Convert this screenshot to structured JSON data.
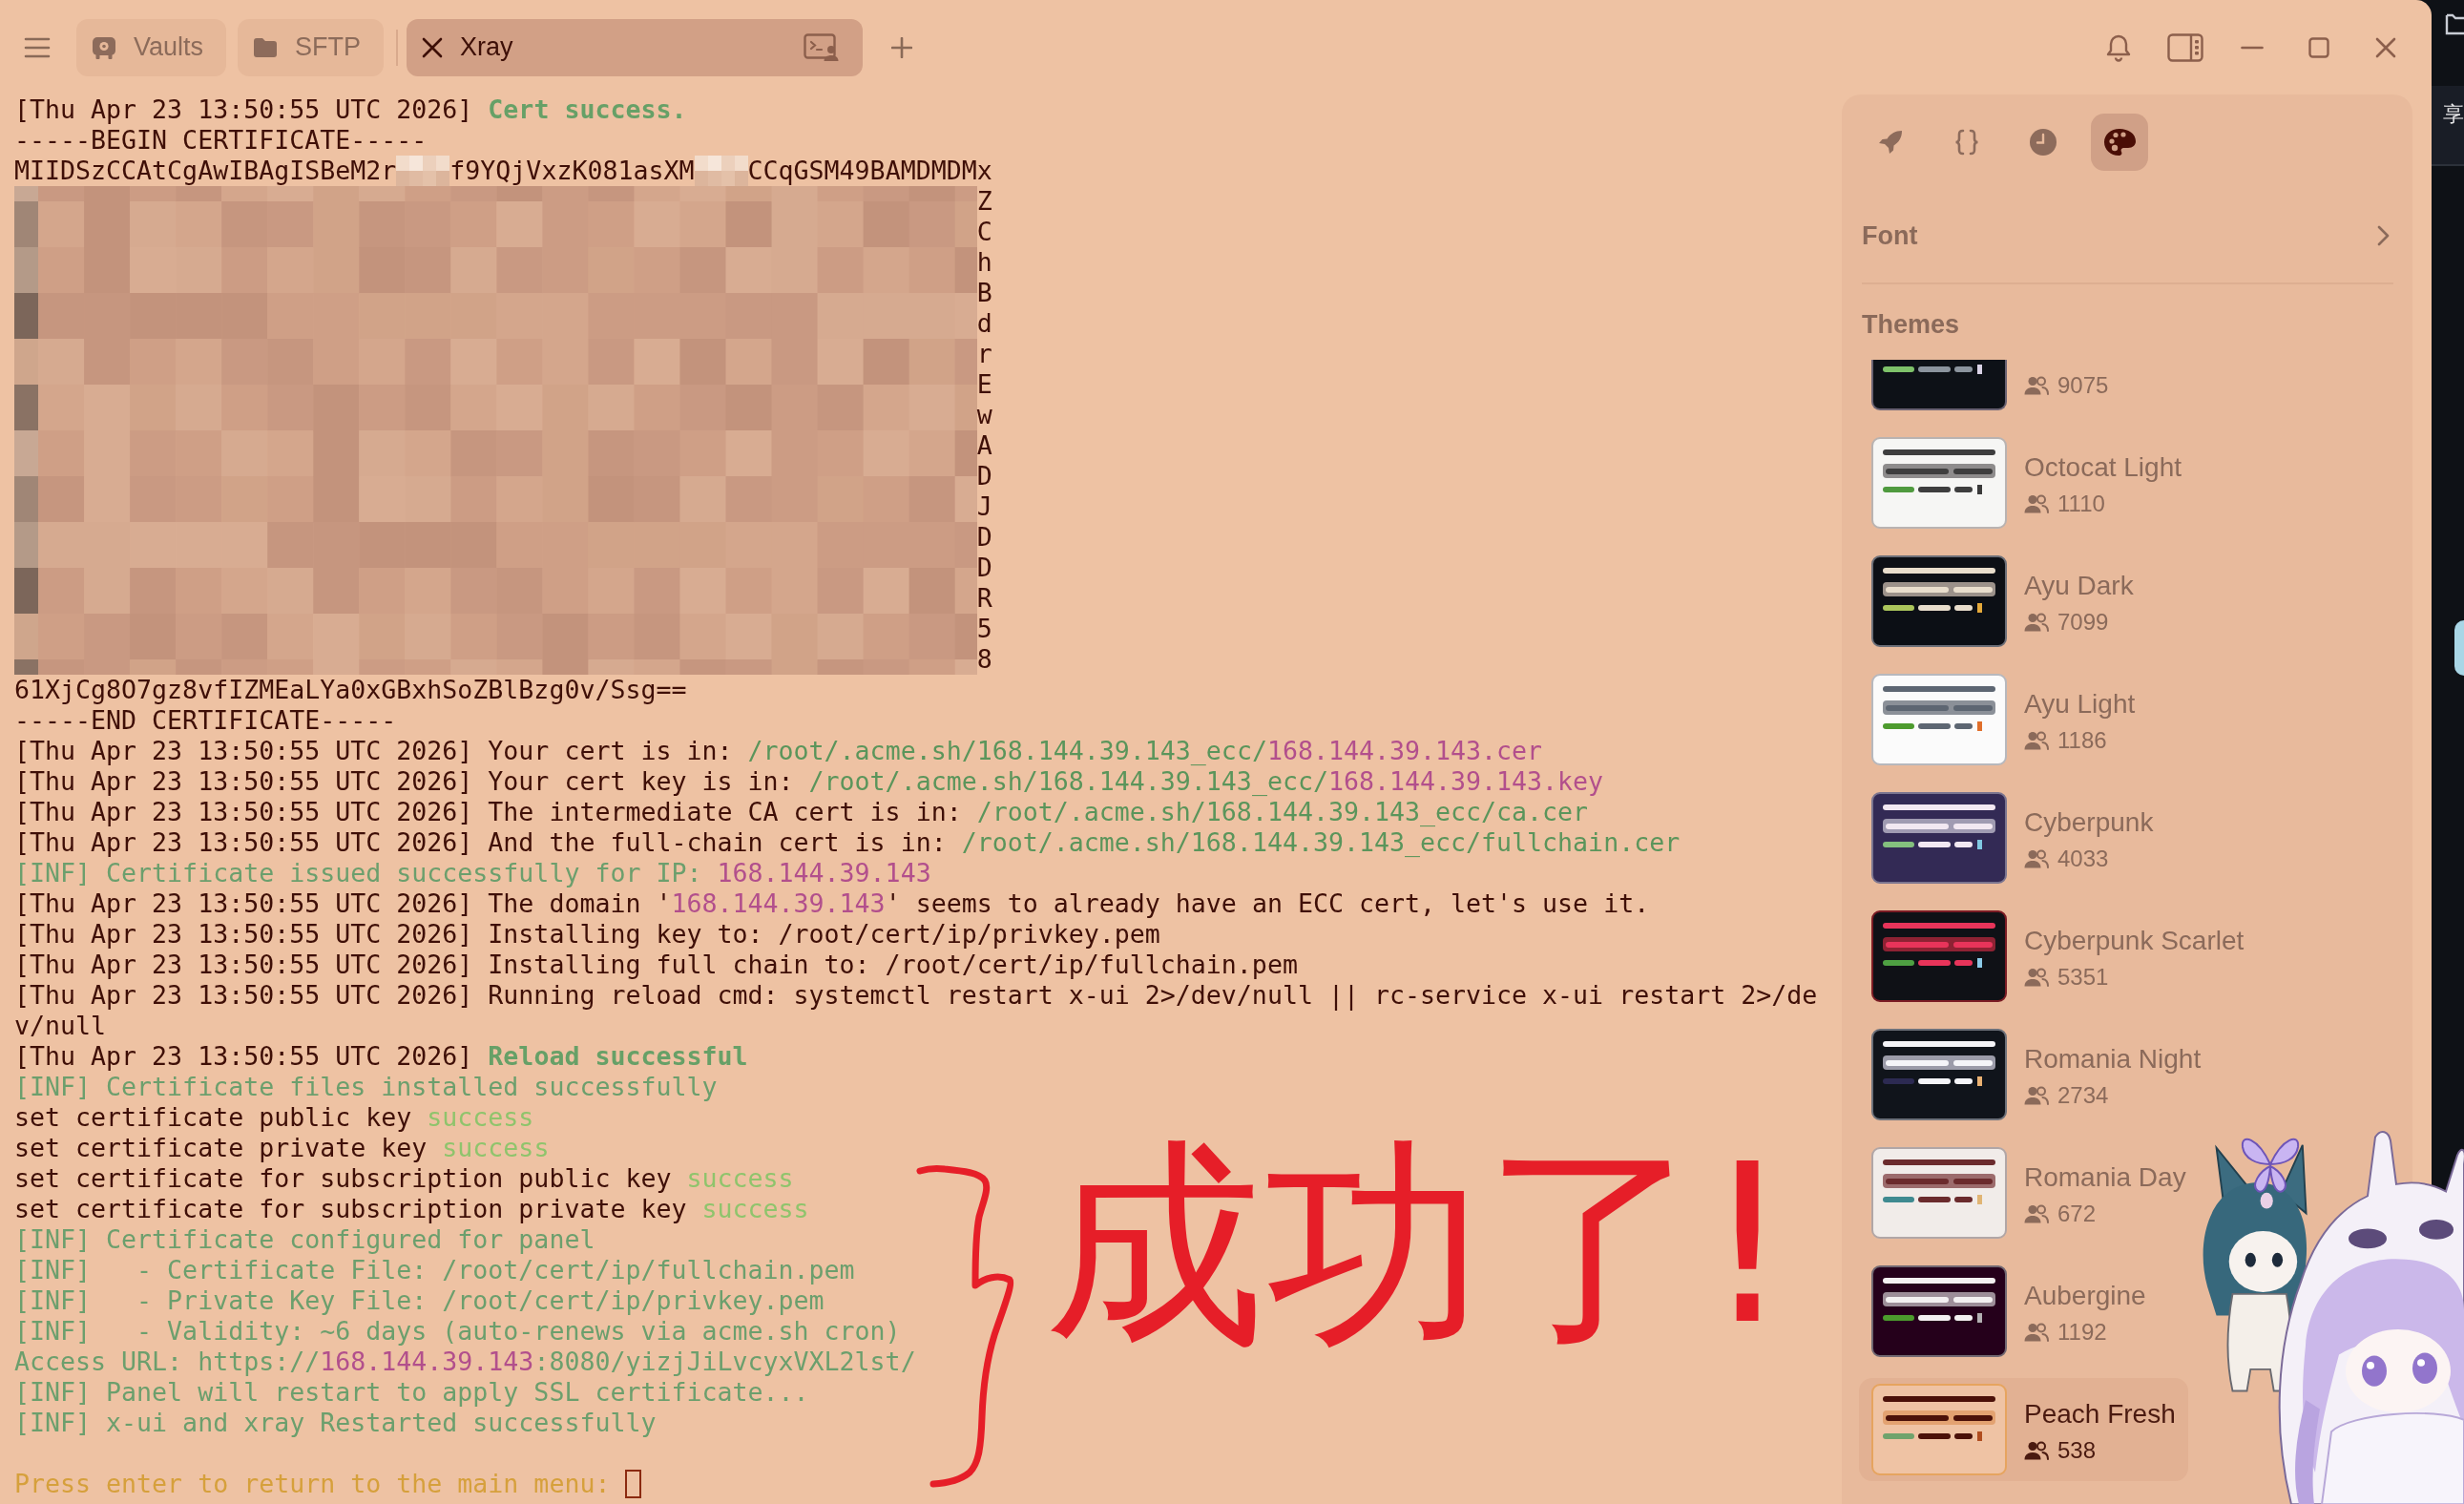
{
  "toolbar": {
    "tabs": [
      {
        "label": "Vaults",
        "kind": "vaults",
        "selected": false
      },
      {
        "label": "SFTP",
        "kind": "sftp",
        "selected": false
      },
      {
        "label": "Xray",
        "kind": "host",
        "selected": true
      }
    ]
  },
  "terminal": {
    "lines": [
      {
        "segments": [
          {
            "kind": "plain",
            "text": "[Thu Apr 23 13:50:55 UTC 2026] "
          },
          {
            "kind": "success",
            "text": "Cert success."
          }
        ]
      },
      {
        "segments": [
          {
            "kind": "plain",
            "text": "-----BEGIN CERTIFICATE-----"
          }
        ]
      },
      {
        "segments": [
          {
            "kind": "plain",
            "text": "MIIDSzCCAtCgAwIBAgISBeM2r"
          },
          {
            "kind": "redacted"
          },
          {
            "kind": "plain",
            "text": "f9YQjVxzK081asXM"
          },
          {
            "kind": "redacted"
          },
          {
            "kind": "plain",
            "text": "CCqGSM49BAMDMDMx"
          }
        ]
      },
      {
        "segments": [
          {
            "kind": "redacted_block"
          },
          {
            "kind": "plain",
            "text": "Z"
          }
        ]
      },
      {
        "segments": [
          {
            "kind": "redacted_block"
          },
          {
            "kind": "plain",
            "text": "C"
          }
        ]
      },
      {
        "segments": [
          {
            "kind": "redacted_block"
          },
          {
            "kind": "plain",
            "text": "h"
          }
        ]
      },
      {
        "segments": [
          {
            "kind": "redacted_block"
          },
          {
            "kind": "plain",
            "text": "B"
          }
        ]
      },
      {
        "segments": [
          {
            "kind": "redacted_block"
          },
          {
            "kind": "plain",
            "text": "d"
          }
        ]
      },
      {
        "segments": [
          {
            "kind": "redacted_block"
          },
          {
            "kind": "plain",
            "text": "r"
          }
        ]
      },
      {
        "segments": [
          {
            "kind": "redacted_block"
          },
          {
            "kind": "plain",
            "text": "E"
          }
        ]
      },
      {
        "segments": [
          {
            "kind": "redacted_block"
          },
          {
            "kind": "plain",
            "text": "w"
          }
        ]
      },
      {
        "segments": [
          {
            "kind": "redacted_block"
          },
          {
            "kind": "plain",
            "text": "A"
          }
        ]
      },
      {
        "segments": [
          {
            "kind": "redacted_block"
          },
          {
            "kind": "plain",
            "text": "D"
          }
        ]
      },
      {
        "segments": [
          {
            "kind": "redacted_block"
          },
          {
            "kind": "plain",
            "text": "J"
          }
        ]
      },
      {
        "segments": [
          {
            "kind": "redacted_block"
          },
          {
            "kind": "plain",
            "text": "D"
          }
        ]
      },
      {
        "segments": [
          {
            "kind": "redacted_block"
          },
          {
            "kind": "plain",
            "text": "D"
          }
        ]
      },
      {
        "segments": [
          {
            "kind": "redacted_block"
          },
          {
            "kind": "plain",
            "text": "R"
          }
        ]
      },
      {
        "segments": [
          {
            "kind": "redacted_block"
          },
          {
            "kind": "plain",
            "text": "5"
          }
        ]
      },
      {
        "segments": [
          {
            "kind": "redacted_block"
          },
          {
            "kind": "plain",
            "text": "8"
          }
        ]
      },
      {
        "segments": [
          {
            "kind": "plain",
            "text": "61XjCg8O7gz8vfIZMEaLYa0xGBxhSoZBlBzg0v/Ssg=="
          }
        ]
      },
      {
        "segments": [
          {
            "kind": "plain",
            "text": "-----END CERTIFICATE-----"
          }
        ]
      },
      {
        "segments": [
          {
            "kind": "plain",
            "text": "[Thu Apr 23 13:50:55 UTC 2026] Your cert is in: "
          },
          {
            "kind": "path",
            "text": "/root/.acme.sh/168.144.39.143_ecc/"
          },
          {
            "kind": "ip",
            "text": "168.144.39.143.cer"
          }
        ]
      },
      {
        "segments": [
          {
            "kind": "plain",
            "text": "[Thu Apr 23 13:50:55 UTC 2026] Your cert key is in: "
          },
          {
            "kind": "path",
            "text": "/root/.acme.sh/168.144.39.143_ecc/"
          },
          {
            "kind": "ip",
            "text": "168.144.39.143.key"
          }
        ]
      },
      {
        "segments": [
          {
            "kind": "plain",
            "text": "[Thu Apr 23 13:50:55 UTC 2026] The intermediate CA cert is in: "
          },
          {
            "kind": "path",
            "text": "/root/.acme.sh/168.144.39.143_ecc/ca.cer"
          }
        ]
      },
      {
        "segments": [
          {
            "kind": "plain",
            "text": "[Thu Apr 23 13:50:55 UTC 2026] And the full-chain cert is in: "
          },
          {
            "kind": "path",
            "text": "/root/.acme.sh/168.144.39.143_ecc/fullchain.cer"
          }
        ]
      },
      {
        "segments": [
          {
            "kind": "info",
            "text": "[INF] Certificate issued successfully for IP: "
          },
          {
            "kind": "ip",
            "text": "168.144.39.143"
          }
        ]
      },
      {
        "segments": [
          {
            "kind": "plain",
            "text": "[Thu Apr 23 13:50:55 UTC 2026] The domain '"
          },
          {
            "kind": "ip",
            "text": "168.144.39.143"
          },
          {
            "kind": "plain",
            "text": "' seems to already have an ECC cert, let's use it."
          }
        ]
      },
      {
        "segments": [
          {
            "kind": "plain",
            "text": "[Thu Apr 23 13:50:55 UTC 2026] Installing key to: /root/cert/ip/privkey.pem"
          }
        ]
      },
      {
        "segments": [
          {
            "kind": "plain",
            "text": "[Thu Apr 23 13:50:55 UTC 2026] Installing full chain to: /root/cert/ip/fullchain.pem"
          }
        ]
      },
      {
        "segments": [
          {
            "kind": "plain",
            "text": "[Thu Apr 23 13:50:55 UTC 2026] Running reload cmd: systemctl restart x-ui 2>/dev/null || rc-service x-ui restart 2>/de"
          }
        ]
      },
      {
        "segments": [
          {
            "kind": "plain",
            "text": "v/null"
          }
        ]
      },
      {
        "segments": [
          {
            "kind": "plain",
            "text": "[Thu Apr 23 13:50:55 UTC 2026] "
          },
          {
            "kind": "success",
            "text": "Reload successful"
          }
        ]
      },
      {
        "segments": [
          {
            "kind": "info",
            "text": "[INF] Certificate files installed successfully"
          }
        ]
      },
      {
        "segments": [
          {
            "kind": "plain",
            "text": "set certificate public key "
          },
          {
            "kind": "ok",
            "text": "success"
          }
        ]
      },
      {
        "segments": [
          {
            "kind": "plain",
            "text": "set certificate private key "
          },
          {
            "kind": "ok",
            "text": "success"
          }
        ]
      },
      {
        "segments": [
          {
            "kind": "plain",
            "text": "set certificate for subscription public key "
          },
          {
            "kind": "ok",
            "text": "success"
          }
        ]
      },
      {
        "segments": [
          {
            "kind": "plain",
            "text": "set certificate for subscription private key "
          },
          {
            "kind": "ok",
            "text": "success"
          }
        ]
      },
      {
        "segments": [
          {
            "kind": "info",
            "text": "[INF] Certificate configured for panel"
          }
        ]
      },
      {
        "segments": [
          {
            "kind": "info",
            "text": "[INF]   - Certificate File: /root/cert/ip/fullchain.pem"
          }
        ]
      },
      {
        "segments": [
          {
            "kind": "info",
            "text": "[INF]   - Private Key File: /root/cert/ip/privkey.pem"
          }
        ]
      },
      {
        "segments": [
          {
            "kind": "info",
            "text": "[INF]   - Validity: ~6 days (auto-renews via acme.sh cron)"
          }
        ]
      },
      {
        "segments": [
          {
            "kind": "info",
            "text": "Access URL: https://"
          },
          {
            "kind": "ip",
            "text": "168.144.39.143"
          },
          {
            "kind": "info",
            "text": ":8080/yizjJiLvcyxVXL2lst/"
          }
        ]
      },
      {
        "segments": [
          {
            "kind": "info",
            "text": "[INF] Panel will restart to apply SSL certificate..."
          }
        ]
      },
      {
        "segments": [
          {
            "kind": "info",
            "text": "[INF] x-ui and xray Restarted successfully"
          }
        ]
      }
    ],
    "prompt": {
      "text": "Press enter to return to the main menu: ",
      "cursor": true
    }
  },
  "annotation": {
    "text": "成功了!"
  },
  "side_panel": {
    "tools": [
      {
        "selected": false
      },
      {
        "selected": false
      },
      {
        "selected": false
      },
      {
        "selected": true
      }
    ],
    "font_row": {
      "label": "Font"
    },
    "themes": {
      "heading": "Themes",
      "items": [
        {
          "users": "9075",
          "selected": false,
          "palette": [
            {
              "color": "#0d1117"
            },
            {
              "color": "#6a6272"
            },
            {
              "color": "#8b949e"
            },
            {
              "color": "#7ec26a"
            },
            {
              "color": "#d9d2e6"
            }
          ]
        },
        {
          "name": "Octocat Light",
          "users": "1110",
          "selected": false,
          "palette": [
            {
              "color": "#f6f6f4"
            },
            {
              "color": "#b9b3b1"
            },
            {
              "color": "#3e3e3e"
            },
            {
              "color": "#4f9a3e"
            },
            {
              "color": "#3a3a3a"
            },
            {
              "color": "#8e8c8c"
            }
          ]
        },
        {
          "name": "Ayu Dark",
          "users": "7099",
          "selected": false,
          "palette": [
            {
              "color": "#0c0f15"
            },
            {
              "color": "#6c6f78"
            },
            {
              "color": "#e8ddcc"
            },
            {
              "color": "#abc55c"
            },
            {
              "color": "#e5a93a"
            },
            {
              "color": "#9b918a"
            }
          ]
        },
        {
          "name": "Ayu Light",
          "users": "1186",
          "selected": false,
          "palette": [
            {
              "color": "#fbfbfb"
            },
            {
              "color": "#b7b8bd"
            },
            {
              "color": "#5d6672"
            },
            {
              "color": "#4d9b2e"
            },
            {
              "color": "#e06f2b"
            },
            {
              "color": "#8b9098"
            }
          ]
        },
        {
          "name": "Cyberpunk",
          "users": "4033",
          "selected": false,
          "palette": [
            {
              "color": "#332a55"
            },
            {
              "color": "#7b7590"
            },
            {
              "color": "#f2e8f2"
            },
            {
              "color": "#84c07e"
            },
            {
              "color": "#80c8e2"
            },
            {
              "color": "#a09bb2"
            }
          ]
        },
        {
          "name": "Cyberpunk Scarlet",
          "users": "5351",
          "selected": false,
          "palette": [
            {
              "color": "#0f1116"
            },
            {
              "color": "#7b1c24"
            },
            {
              "color": "#e8345a"
            },
            {
              "color": "#4ea042"
            },
            {
              "color": "#8ccbe8"
            },
            {
              "color": "#8e2233"
            }
          ]
        },
        {
          "name": "Romania Night",
          "users": "2734",
          "selected": false,
          "palette": [
            {
              "color": "#10141b"
            },
            {
              "color": "#6d717a"
            },
            {
              "color": "#f4f4f8"
            },
            {
              "color": "#2c2a52"
            },
            {
              "color": "#eab172"
            },
            {
              "color": "#9b9ba9"
            }
          ]
        },
        {
          "name": "Romania Day",
          "users": "672",
          "selected": false,
          "palette": [
            {
              "color": "#f1ece9"
            },
            {
              "color": "#b1a6a6"
            },
            {
              "color": "#6b2b2d"
            },
            {
              "color": "#3f8a90"
            },
            {
              "color": "#e1b574"
            },
            {
              "color": "#9c6b6c"
            }
          ]
        },
        {
          "name": "Aubergine",
          "users": "1192",
          "selected": false,
          "palette": [
            {
              "color": "#25001b"
            },
            {
              "color": "#716872"
            },
            {
              "color": "#f3f0f1"
            },
            {
              "color": "#4c9b2d"
            },
            {
              "color": "#b3b0b3"
            },
            {
              "color": "#9d8e99"
            }
          ]
        },
        {
          "name": "Peach Fresh",
          "users": "538",
          "selected": true,
          "palette": [
            {
              "color": "#efc3a4"
            },
            {
              "color": "#e6a45f"
            },
            {
              "color": "#4b1109"
            },
            {
              "color": "#6fa36c"
            },
            {
              "color": "#b04d1f"
            },
            {
              "color": "#e3a271"
            }
          ]
        }
      ]
    }
  },
  "background_window": {
    "text": "享"
  }
}
